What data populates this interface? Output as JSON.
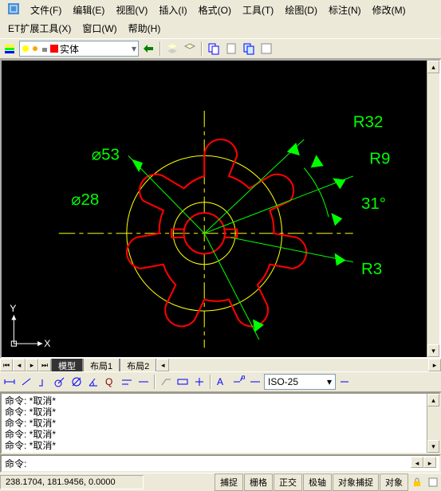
{
  "menu": {
    "file": "文件(F)",
    "edit": "编辑(E)",
    "view": "视图(V)",
    "insert": "插入(I)",
    "format": "格式(O)",
    "tools": "工具(T)",
    "draw": "绘图(D)",
    "dimension": "标注(N)",
    "modify": "修改(M)",
    "express": "ET扩展工具(X)",
    "window": "窗口(W)",
    "help": "帮助(H)"
  },
  "layer": {
    "name": "实体",
    "color": "#ff0000"
  },
  "tabs": {
    "model": "模型",
    "layout1": "布局1",
    "layout2": "布局2"
  },
  "dimstyle": "ISO-25",
  "drawing": {
    "labels": {
      "r32": "R32",
      "r9": "R9",
      "r3": "R3",
      "ang31": "31°",
      "d53": "⌀53",
      "d28": "⌀28"
    },
    "ucs": {
      "x": "X",
      "y": "Y"
    }
  },
  "cmd": {
    "line1": "命令: *取消*",
    "line2": "命令: *取消*",
    "line3": "命令: *取消*",
    "line4": "命令: *取消*",
    "line5": "命令: *取消*",
    "prompt": "命令:"
  },
  "status": {
    "coords": "238.1704, 181.9456, 0.0000",
    "snap": "捕捉",
    "grid": "栅格",
    "ortho": "正交",
    "polar": "极轴",
    "osnap": "对象捕捉",
    "otrack": "对象"
  }
}
